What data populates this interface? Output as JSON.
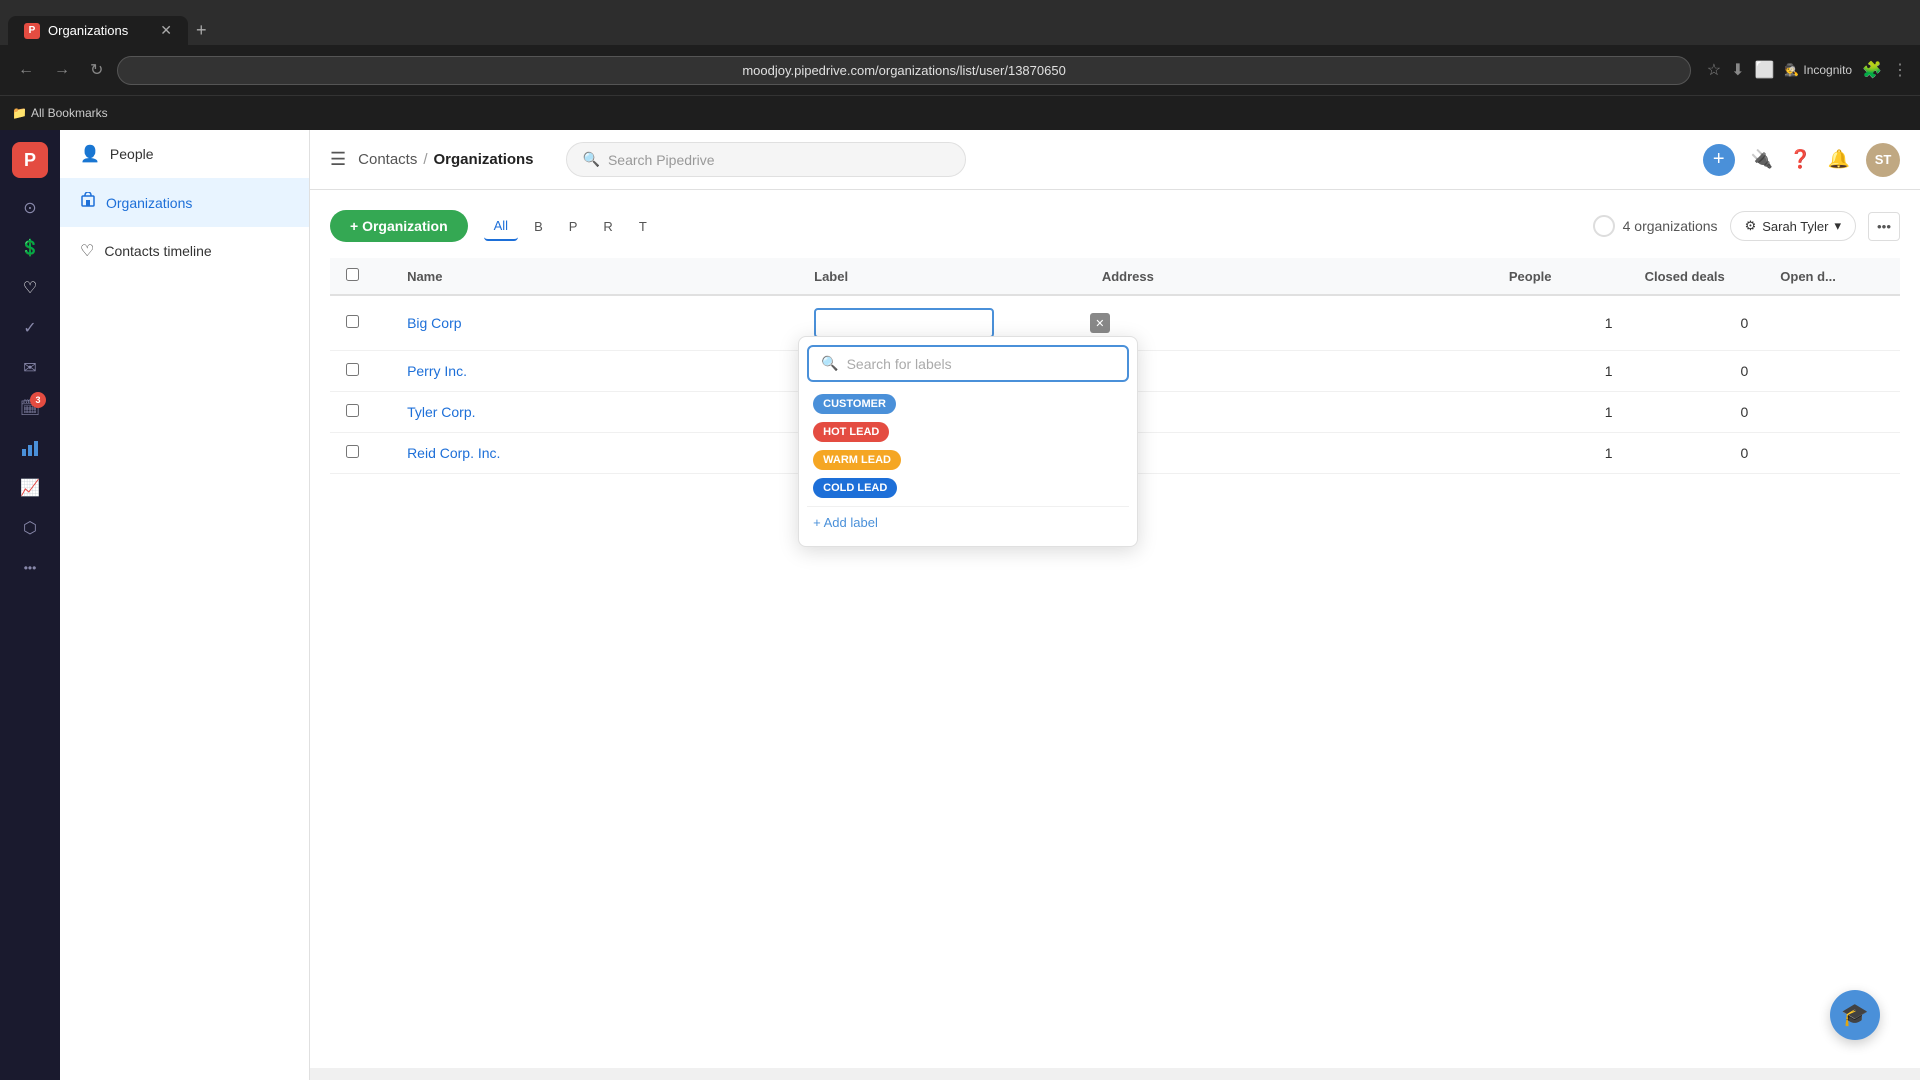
{
  "browser": {
    "tab_title": "Organizations",
    "tab_icon": "P",
    "address_bar": "moodjoy.pipedrive.com/organizations/list/user/13870650",
    "incognito_label": "Incognito",
    "bookmarks_label": "All Bookmarks"
  },
  "header": {
    "menu_toggle": "≡",
    "breadcrumb_parent": "Contacts",
    "breadcrumb_sep": "/",
    "breadcrumb_current": "Organizations",
    "search_placeholder": "Search Pipedrive",
    "add_label": "+"
  },
  "sidebar": {
    "logo": "P",
    "icons": [
      {
        "name": "home-icon",
        "symbol": "⊙",
        "active": false
      },
      {
        "name": "deals-icon",
        "symbol": "$",
        "active": false
      },
      {
        "name": "contacts-icon",
        "symbol": "♡",
        "active": false
      },
      {
        "name": "activities-icon",
        "symbol": "✓",
        "active": false
      },
      {
        "name": "mail-icon",
        "symbol": "✉",
        "active": false
      },
      {
        "name": "calendar-icon",
        "symbol": "📅",
        "badge": "3",
        "active": false
      },
      {
        "name": "reports-icon",
        "symbol": "📊",
        "active": true
      },
      {
        "name": "insights-icon",
        "symbol": "📈",
        "active": false
      },
      {
        "name": "products-icon",
        "symbol": "⬡",
        "active": false
      },
      {
        "name": "more-icon",
        "symbol": "···",
        "active": false
      }
    ]
  },
  "nav_panel": {
    "items": [
      {
        "id": "people",
        "label": "People",
        "icon": "👤",
        "active": false
      },
      {
        "id": "organizations",
        "label": "Organizations",
        "icon": "🏢",
        "active": true
      },
      {
        "id": "contacts-timeline",
        "label": "Contacts timeline",
        "icon": "♡",
        "active": false
      }
    ]
  },
  "content": {
    "add_button_label": "+ Organization",
    "filters": [
      {
        "id": "all",
        "label": "All",
        "active": true
      },
      {
        "id": "b",
        "label": "B",
        "active": false
      },
      {
        "id": "p",
        "label": "P",
        "active": false
      },
      {
        "id": "r",
        "label": "R",
        "active": false
      },
      {
        "id": "t",
        "label": "T",
        "active": false
      }
    ],
    "org_count": "4 organizations",
    "owner_button": "Sarah Tyler",
    "table": {
      "columns": [
        "",
        "Name",
        "Label",
        "Address",
        "People",
        "Closed deals",
        "Open d..."
      ],
      "rows": [
        {
          "name": "Big Corp",
          "label": "",
          "address": "",
          "people": "1",
          "closed_deals": "0",
          "open": ""
        },
        {
          "name": "Perry Inc.",
          "label": "",
          "address": "",
          "people": "1",
          "closed_deals": "0",
          "open": ""
        },
        {
          "name": "Tyler Corp.",
          "label": "",
          "address": "",
          "people": "1",
          "closed_deals": "0",
          "open": ""
        },
        {
          "name": "Reid Corp. Inc.",
          "label": "",
          "address": "",
          "people": "1",
          "closed_deals": "0",
          "open": ""
        }
      ]
    },
    "label_dropdown": {
      "search_placeholder": "Search for labels",
      "labels": [
        {
          "id": "customer",
          "text": "CUSTOMER",
          "color_class": "customer"
        },
        {
          "id": "hot-lead",
          "text": "HOT LEAD",
          "color_class": "hot-lead"
        },
        {
          "id": "warm-lead",
          "text": "WARM LEAD",
          "color_class": "warm-lead"
        },
        {
          "id": "cold-lead",
          "text": "COLD LEAD",
          "color_class": "cold-lead"
        }
      ],
      "add_label": "+ Add label"
    }
  },
  "fab": {
    "icon": "🎓"
  }
}
